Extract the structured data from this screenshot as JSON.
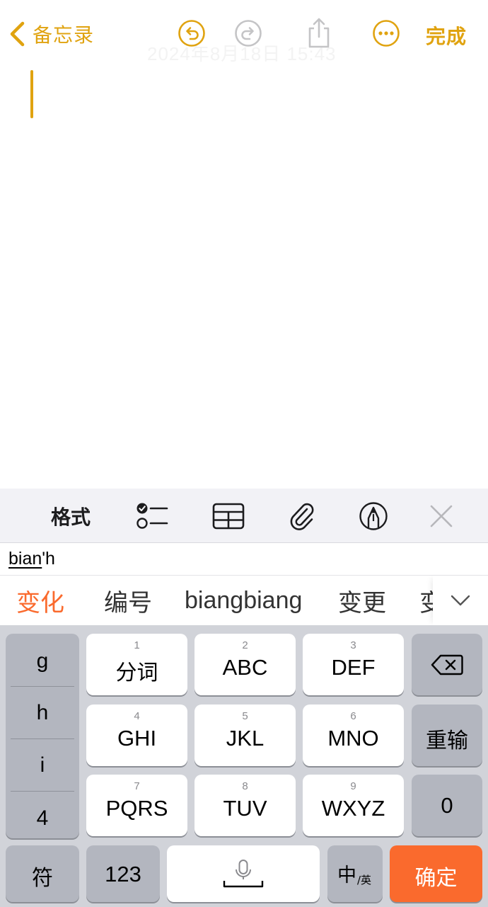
{
  "nav": {
    "back_label": "备忘录",
    "done_label": "完成",
    "ghost_date": "2024年8月18日 15:43",
    "icons": [
      "chevron-left-icon",
      "undo-icon",
      "redo-icon",
      "share-icon",
      "more-icon"
    ]
  },
  "toolbar": {
    "format_label": "格式",
    "icons": [
      "checklist-icon",
      "table-icon",
      "paperclip-icon",
      "markup-pen-icon",
      "close-icon"
    ]
  },
  "ime": {
    "composition_underlined": "bian",
    "composition_rest": "'h",
    "candidates": [
      "变化",
      "编号",
      "biangbiang",
      "变更",
      "变"
    ],
    "expand_icon": "chevron-down-icon"
  },
  "keyboard": {
    "side_letters": [
      "g",
      "h",
      "i",
      "4"
    ],
    "keys": [
      {
        "num": "1",
        "label": "分词"
      },
      {
        "num": "2",
        "label": "ABC"
      },
      {
        "num": "3",
        "label": "DEF"
      },
      {
        "num": "4",
        "label": "GHI"
      },
      {
        "num": "5",
        "label": "JKL"
      },
      {
        "num": "6",
        "label": "MNO"
      },
      {
        "num": "7",
        "label": "PQRS"
      },
      {
        "num": "8",
        "label": "TUV"
      },
      {
        "num": "9",
        "label": "WXYZ"
      }
    ],
    "delete_icon": "backspace-icon",
    "retype_label": "重输",
    "zero_label": "0",
    "symbol_label": "符",
    "numeric_label": "123",
    "space_icon": "microphone-icon",
    "lang_main": "中",
    "lang_sub": "/英",
    "confirm_label": "确定"
  },
  "colors": {
    "accent": "#e0a310",
    "candidate_primary": "#fa6a2d",
    "confirm_key": "#fa6a2d",
    "keyboard_bg": "#d1d3d9",
    "dark_key": "#b3b6bf",
    "disabled_icon": "#c4c4c6"
  }
}
